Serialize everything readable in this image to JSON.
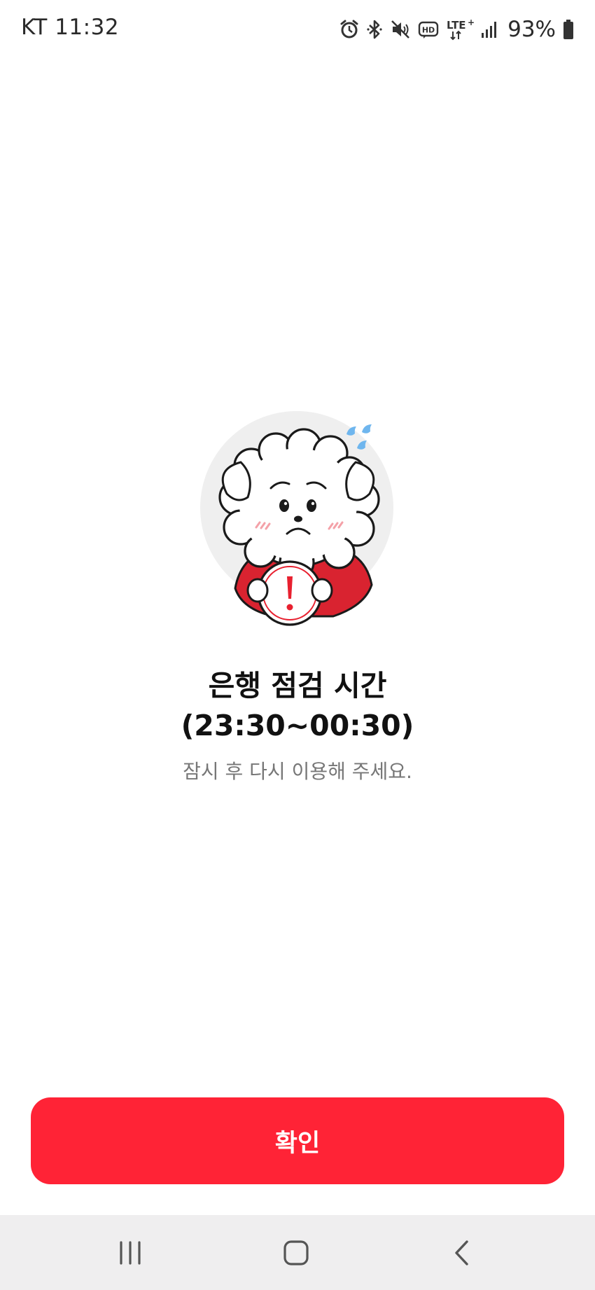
{
  "status_bar": {
    "carrier_time": "KT 11:32",
    "battery": "93%",
    "icons": [
      "alarm-icon",
      "bluetooth-icon",
      "mute-icon",
      "hd-voice-icon",
      "lte-plus-icon",
      "signal-icon",
      "battery-icon"
    ]
  },
  "illustration": {
    "icon": "sad-mascot-with-warning-sign",
    "accent_color": "#e8202f"
  },
  "message": {
    "title_line1": "은행 점검 시간",
    "title_line2": "(23:30~00:30)",
    "subtitle": "잠시 후 다시 이용해 주세요."
  },
  "confirm_button": {
    "label": "확인",
    "color": "#ff2336"
  },
  "nav_bar": {
    "buttons": [
      "recent-apps-icon",
      "home-icon",
      "back-icon"
    ]
  }
}
